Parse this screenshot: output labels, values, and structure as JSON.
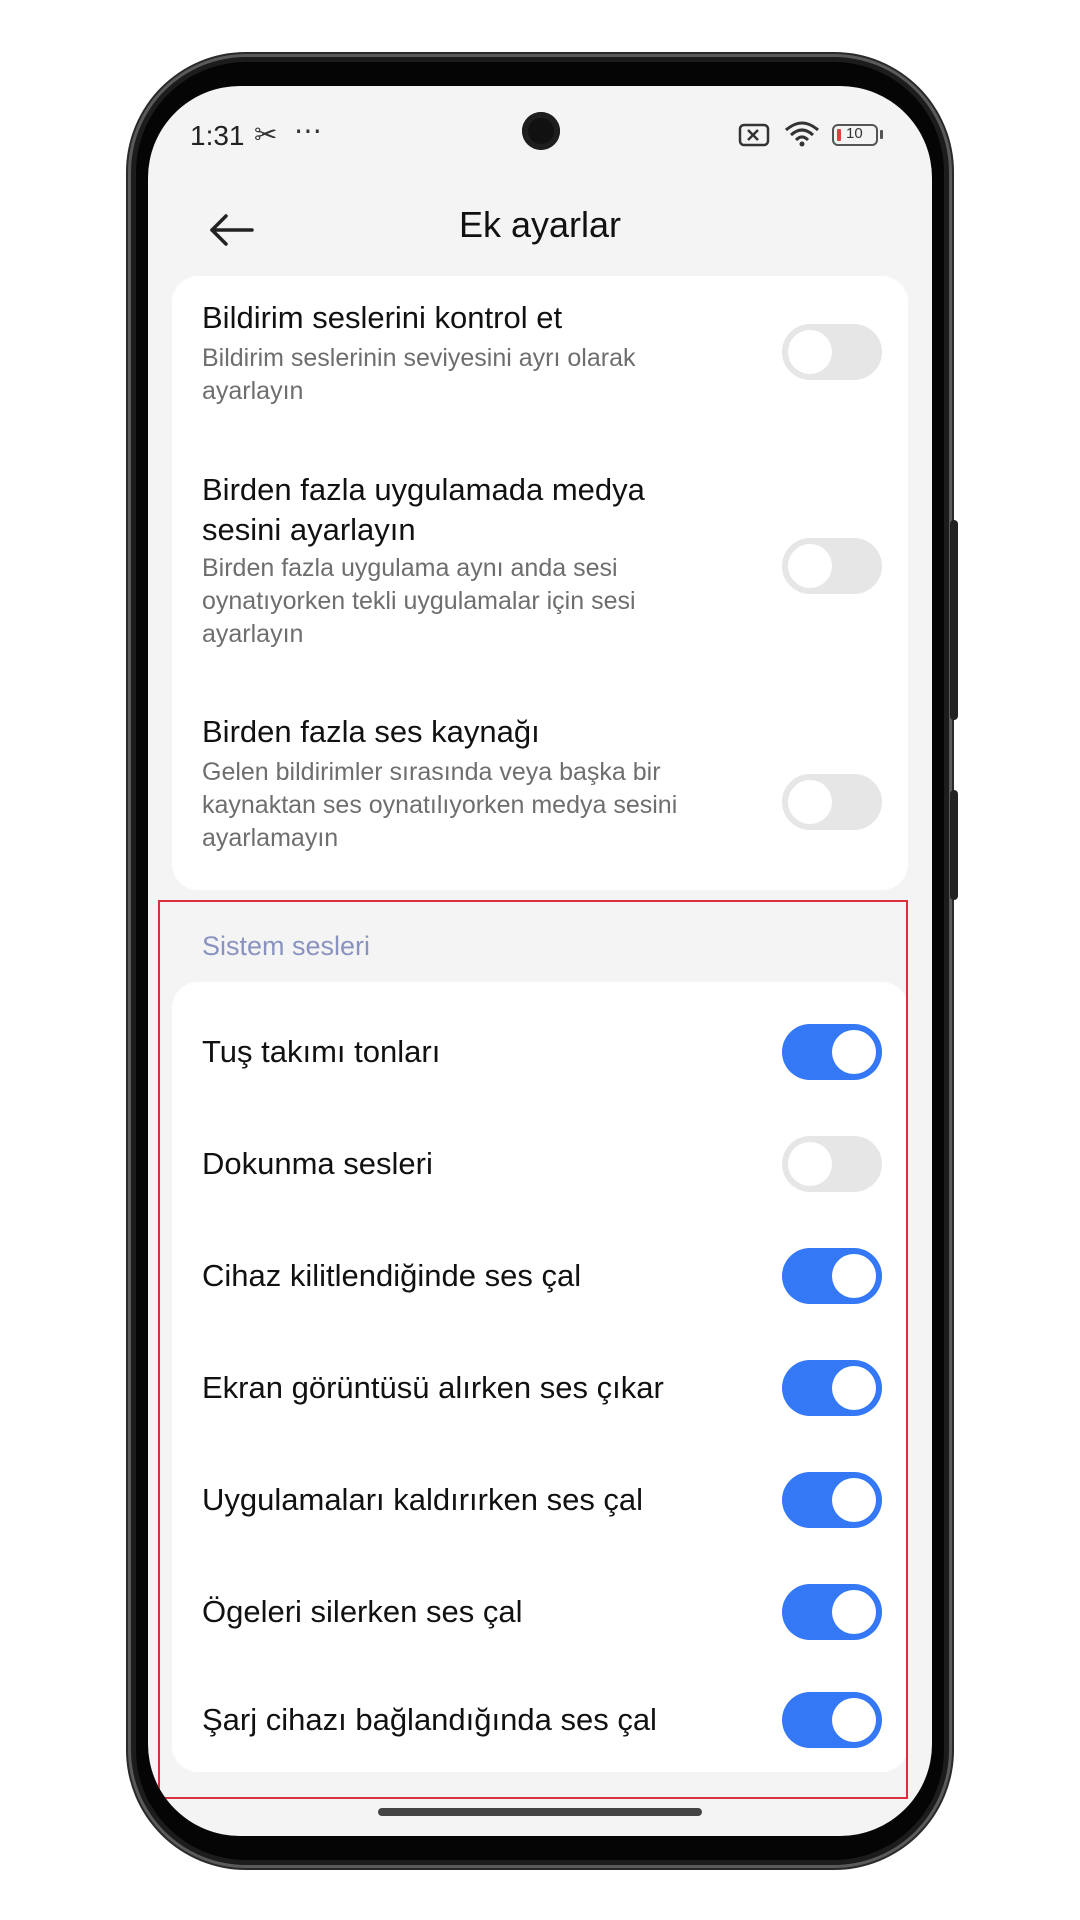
{
  "status_bar": {
    "time": "1:31",
    "left_icons": [
      "scissors-icon",
      "more-dots-icon"
    ],
    "right_icons": [
      "sim-no-signal-icon",
      "wifi-icon",
      "battery-icon"
    ],
    "battery_level": "10"
  },
  "header": {
    "title": "Ek ayarlar",
    "back_icon": "back-arrow-icon"
  },
  "top_card": {
    "items": [
      {
        "title": "Bildirim seslerini kontrol et",
        "subtitle": "Bildirim seslerinin seviyesini ayrı olarak ayarlayın",
        "enabled": false
      },
      {
        "title": "Birden fazla uygulamada medya sesini ayarlayın",
        "subtitle": "Birden fazla uygulama aynı anda sesi oynatıyorken tekli uygulamalar için sesi ayarlayın",
        "enabled": false
      },
      {
        "title": "Birden fazla ses kaynağı",
        "subtitle": "Gelen bildirimler sırasında veya başka bir kaynaktan ses oynatılıyorken medya sesini ayarlamayın",
        "enabled": false
      }
    ]
  },
  "system_sounds": {
    "header": "Sistem sesleri",
    "items": [
      {
        "title": "Tuş takımı tonları",
        "enabled": true
      },
      {
        "title": "Dokunma sesleri",
        "enabled": false
      },
      {
        "title": "Cihaz kilitlendiğinde ses çal",
        "enabled": true
      },
      {
        "title": "Ekran görüntüsü alırken ses çıkar",
        "enabled": true
      },
      {
        "title": "Uygulamaları kaldırırken ses çal",
        "enabled": true
      },
      {
        "title": "Ögeleri silerken ses çal",
        "enabled": true
      },
      {
        "title": "Şarj cihazı bağlandığında ses çal",
        "enabled": true
      }
    ]
  },
  "colors": {
    "toggle_on": "#3478f6",
    "toggle_off": "#e6e6e6",
    "section_header": "#8a93c0",
    "highlight_border": "#d8303c"
  }
}
